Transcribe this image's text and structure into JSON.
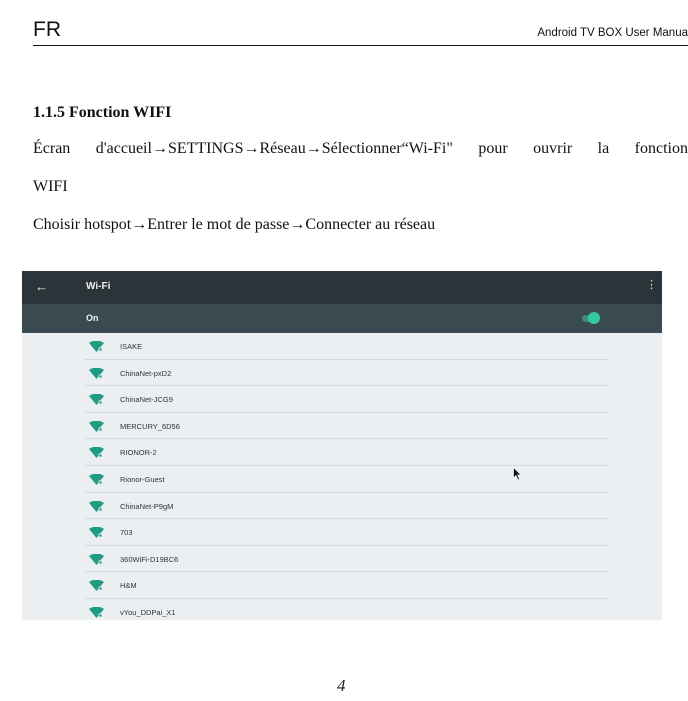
{
  "header": {
    "lang": "FR",
    "manual_title": "Android TV BOX User Manua"
  },
  "section": {
    "title": "1.1.5   Fonction WIFI",
    "para1": "Écran d'accueil→SETTINGS→Réseau→Sélectionner“Wi-Fi\" pour ouvrir la fonction",
    "para1b": "WIFI",
    "para2": "Choisir hotspot→Entrer le mot de passe→Connecter au réseau"
  },
  "screenshot": {
    "topbar": {
      "back_icon": "←",
      "title": "Wi-Fi",
      "more_icon": "⋮"
    },
    "toggle_row": {
      "label": "On",
      "state": "on"
    },
    "networks": [
      "ISAKE",
      "ChinaNet-pxD2",
      "ChinaNet-JCG9",
      "MERCURY_6D56",
      "RIONOR-2",
      "Rionor-Guest",
      "ChinaNet-P9gM",
      "703",
      "360WiFi-D19BC6",
      "H&M",
      "vYou_DDPai_X1"
    ],
    "colors": {
      "topbar": "#2b3439",
      "onbar": "#3a4a51",
      "accent": "#34c9a5",
      "list_bg": "#eceff1"
    }
  },
  "footer": {
    "page_number": "4"
  }
}
